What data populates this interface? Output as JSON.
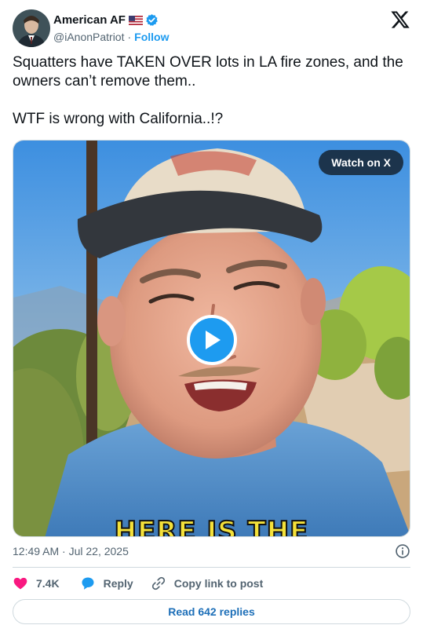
{
  "author": {
    "name": "American AF",
    "flag": "US flag",
    "handle": "@iAnonPatriot",
    "separator": "·",
    "follow_label": "Follow"
  },
  "tweet": {
    "line1": "Squatters have TAKEN OVER lots in LA fire zones, and the owners can’t remove them..",
    "line2": "WTF is wrong with California..!?"
  },
  "media": {
    "watch_label": "Watch on X",
    "caption": "HERE IS THE"
  },
  "meta": {
    "timestamp": "12:49 AM · Jul 22, 2025"
  },
  "actions": {
    "likes": "7.4K",
    "reply_label": "Reply",
    "copy_label": "Copy link to post"
  },
  "footer": {
    "read_replies_label": "Read 642 replies"
  },
  "colors": {
    "accent": "#1d9bf0",
    "text": "#0f1419",
    "muted": "#536471",
    "like": "#f91880"
  }
}
